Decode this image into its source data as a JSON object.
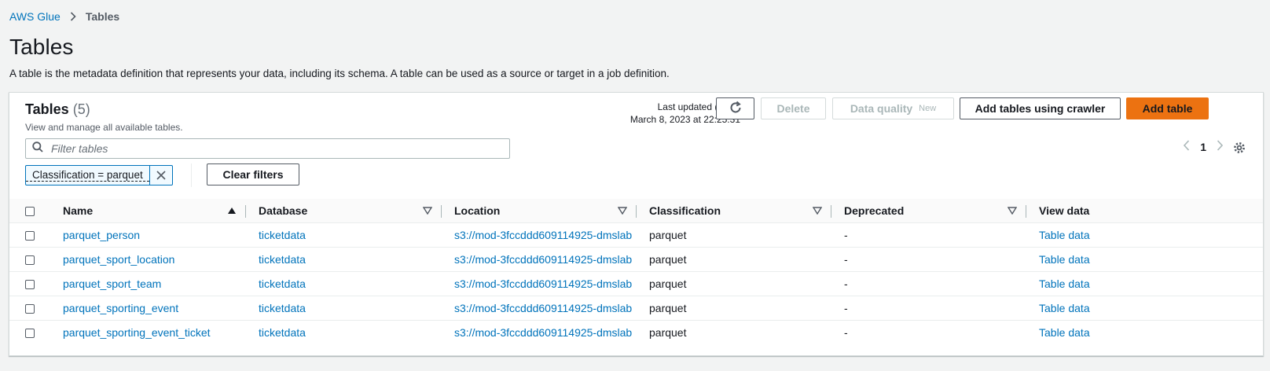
{
  "breadcrumb": {
    "root": "AWS Glue",
    "current": "Tables"
  },
  "page": {
    "title": "Tables",
    "description": "A table is the metadata definition that represents your data, including its schema. A table can be used as a source or target in a job definition."
  },
  "container": {
    "title": "Tables",
    "count": "(5)",
    "description": "View and manage all available tables.",
    "last_updated_label": "Last updated (UTC)",
    "last_updated_value": "March 8, 2023 at 22:25:31"
  },
  "actions": {
    "delete": "Delete",
    "data_quality": "Data quality",
    "data_quality_badge": "New",
    "add_crawler": "Add tables using crawler",
    "add_table": "Add table"
  },
  "filter": {
    "placeholder": "Filter tables",
    "token": "Classification = parquet",
    "clear": "Clear filters"
  },
  "pagination": {
    "current_page": "1"
  },
  "table": {
    "columns": [
      "Name",
      "Database",
      "Location",
      "Classification",
      "Deprecated",
      "View data"
    ],
    "rows": [
      {
        "name": "parquet_person",
        "database": "ticketdata",
        "location": "s3://mod-3fccddd609114925-dmslab",
        "classification": "parquet",
        "deprecated": "-",
        "view": "Table data"
      },
      {
        "name": "parquet_sport_location",
        "database": "ticketdata",
        "location": "s3://mod-3fccddd609114925-dmslab",
        "classification": "parquet",
        "deprecated": "-",
        "view": "Table data"
      },
      {
        "name": "parquet_sport_team",
        "database": "ticketdata",
        "location": "s3://mod-3fccddd609114925-dmslab",
        "classification": "parquet",
        "deprecated": "-",
        "view": "Table data"
      },
      {
        "name": "parquet_sporting_event",
        "database": "ticketdata",
        "location": "s3://mod-3fccddd609114925-dmslab",
        "classification": "parquet",
        "deprecated": "-",
        "view": "Table data"
      },
      {
        "name": "parquet_sporting_event_ticket",
        "database": "ticketdata",
        "location": "s3://mod-3fccddd609114925-dmslab",
        "classification": "parquet",
        "deprecated": "-",
        "view": "Table data"
      }
    ]
  },
  "colors": {
    "link": "#0073bb",
    "primary": "#ec7211",
    "background": "#f2f3f3"
  }
}
